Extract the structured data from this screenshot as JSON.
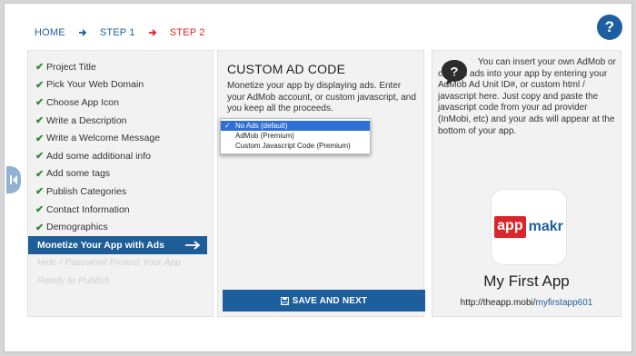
{
  "breadcrumb": {
    "home": "HOME",
    "step1": "STEP 1",
    "step2": "STEP 2",
    "step1_arrow_color": "#1d5f9a",
    "step2_arrow_color": "#d8262b"
  },
  "help": {
    "label": "?"
  },
  "sidebar": {
    "items": [
      {
        "label": "Project Title",
        "state": "done"
      },
      {
        "label": "Pick Your Web Domain",
        "state": "done"
      },
      {
        "label": "Choose App Icon",
        "state": "done"
      },
      {
        "label": "Write a Description",
        "state": "done"
      },
      {
        "label": "Write a Welcome Message",
        "state": "done"
      },
      {
        "label": "Add some additional info",
        "state": "done"
      },
      {
        "label": "Add some tags",
        "state": "done"
      },
      {
        "label": "Publish Categories",
        "state": "done"
      },
      {
        "label": "Contact Information",
        "state": "done"
      },
      {
        "label": "Demographics",
        "state": "done"
      },
      {
        "label": "Monetize Your App with Ads",
        "state": "active"
      },
      {
        "label": "Hide / Password Protect Your App",
        "state": "disabled"
      },
      {
        "label": "Ready to Publish",
        "state": "disabled"
      }
    ]
  },
  "main": {
    "title": "CUSTOM AD CODE",
    "description": "Monetize your app by displaying ads. Enter your AdMob account, or custom javascript, and you keep all the proceeds.",
    "dropdown": {
      "options": [
        "No Ads (default)",
        "AdMob (Premium)",
        "Custom Javascript Code (Premium)"
      ],
      "selected_index": 0
    },
    "save_label": "SAVE AND NEXT"
  },
  "info": {
    "text": "You can insert your own AdMob or custom ads into your app by entering your AdMob Ad Unit ID#, or custom html / javascript here. Just copy and paste the javascript code from your ad provider (InMobi, etc) and your ads will appear at the bottom of your app.",
    "logo_app": "app",
    "logo_makr": "makr",
    "app_name": "My First App",
    "url_prefix": "http://theapp.mobi/",
    "url_slug": "myfirstapp601"
  },
  "colors": {
    "brand_blue": "#1d5e9c",
    "accent_red": "#d8262b",
    "check_green": "#2e8b35"
  }
}
